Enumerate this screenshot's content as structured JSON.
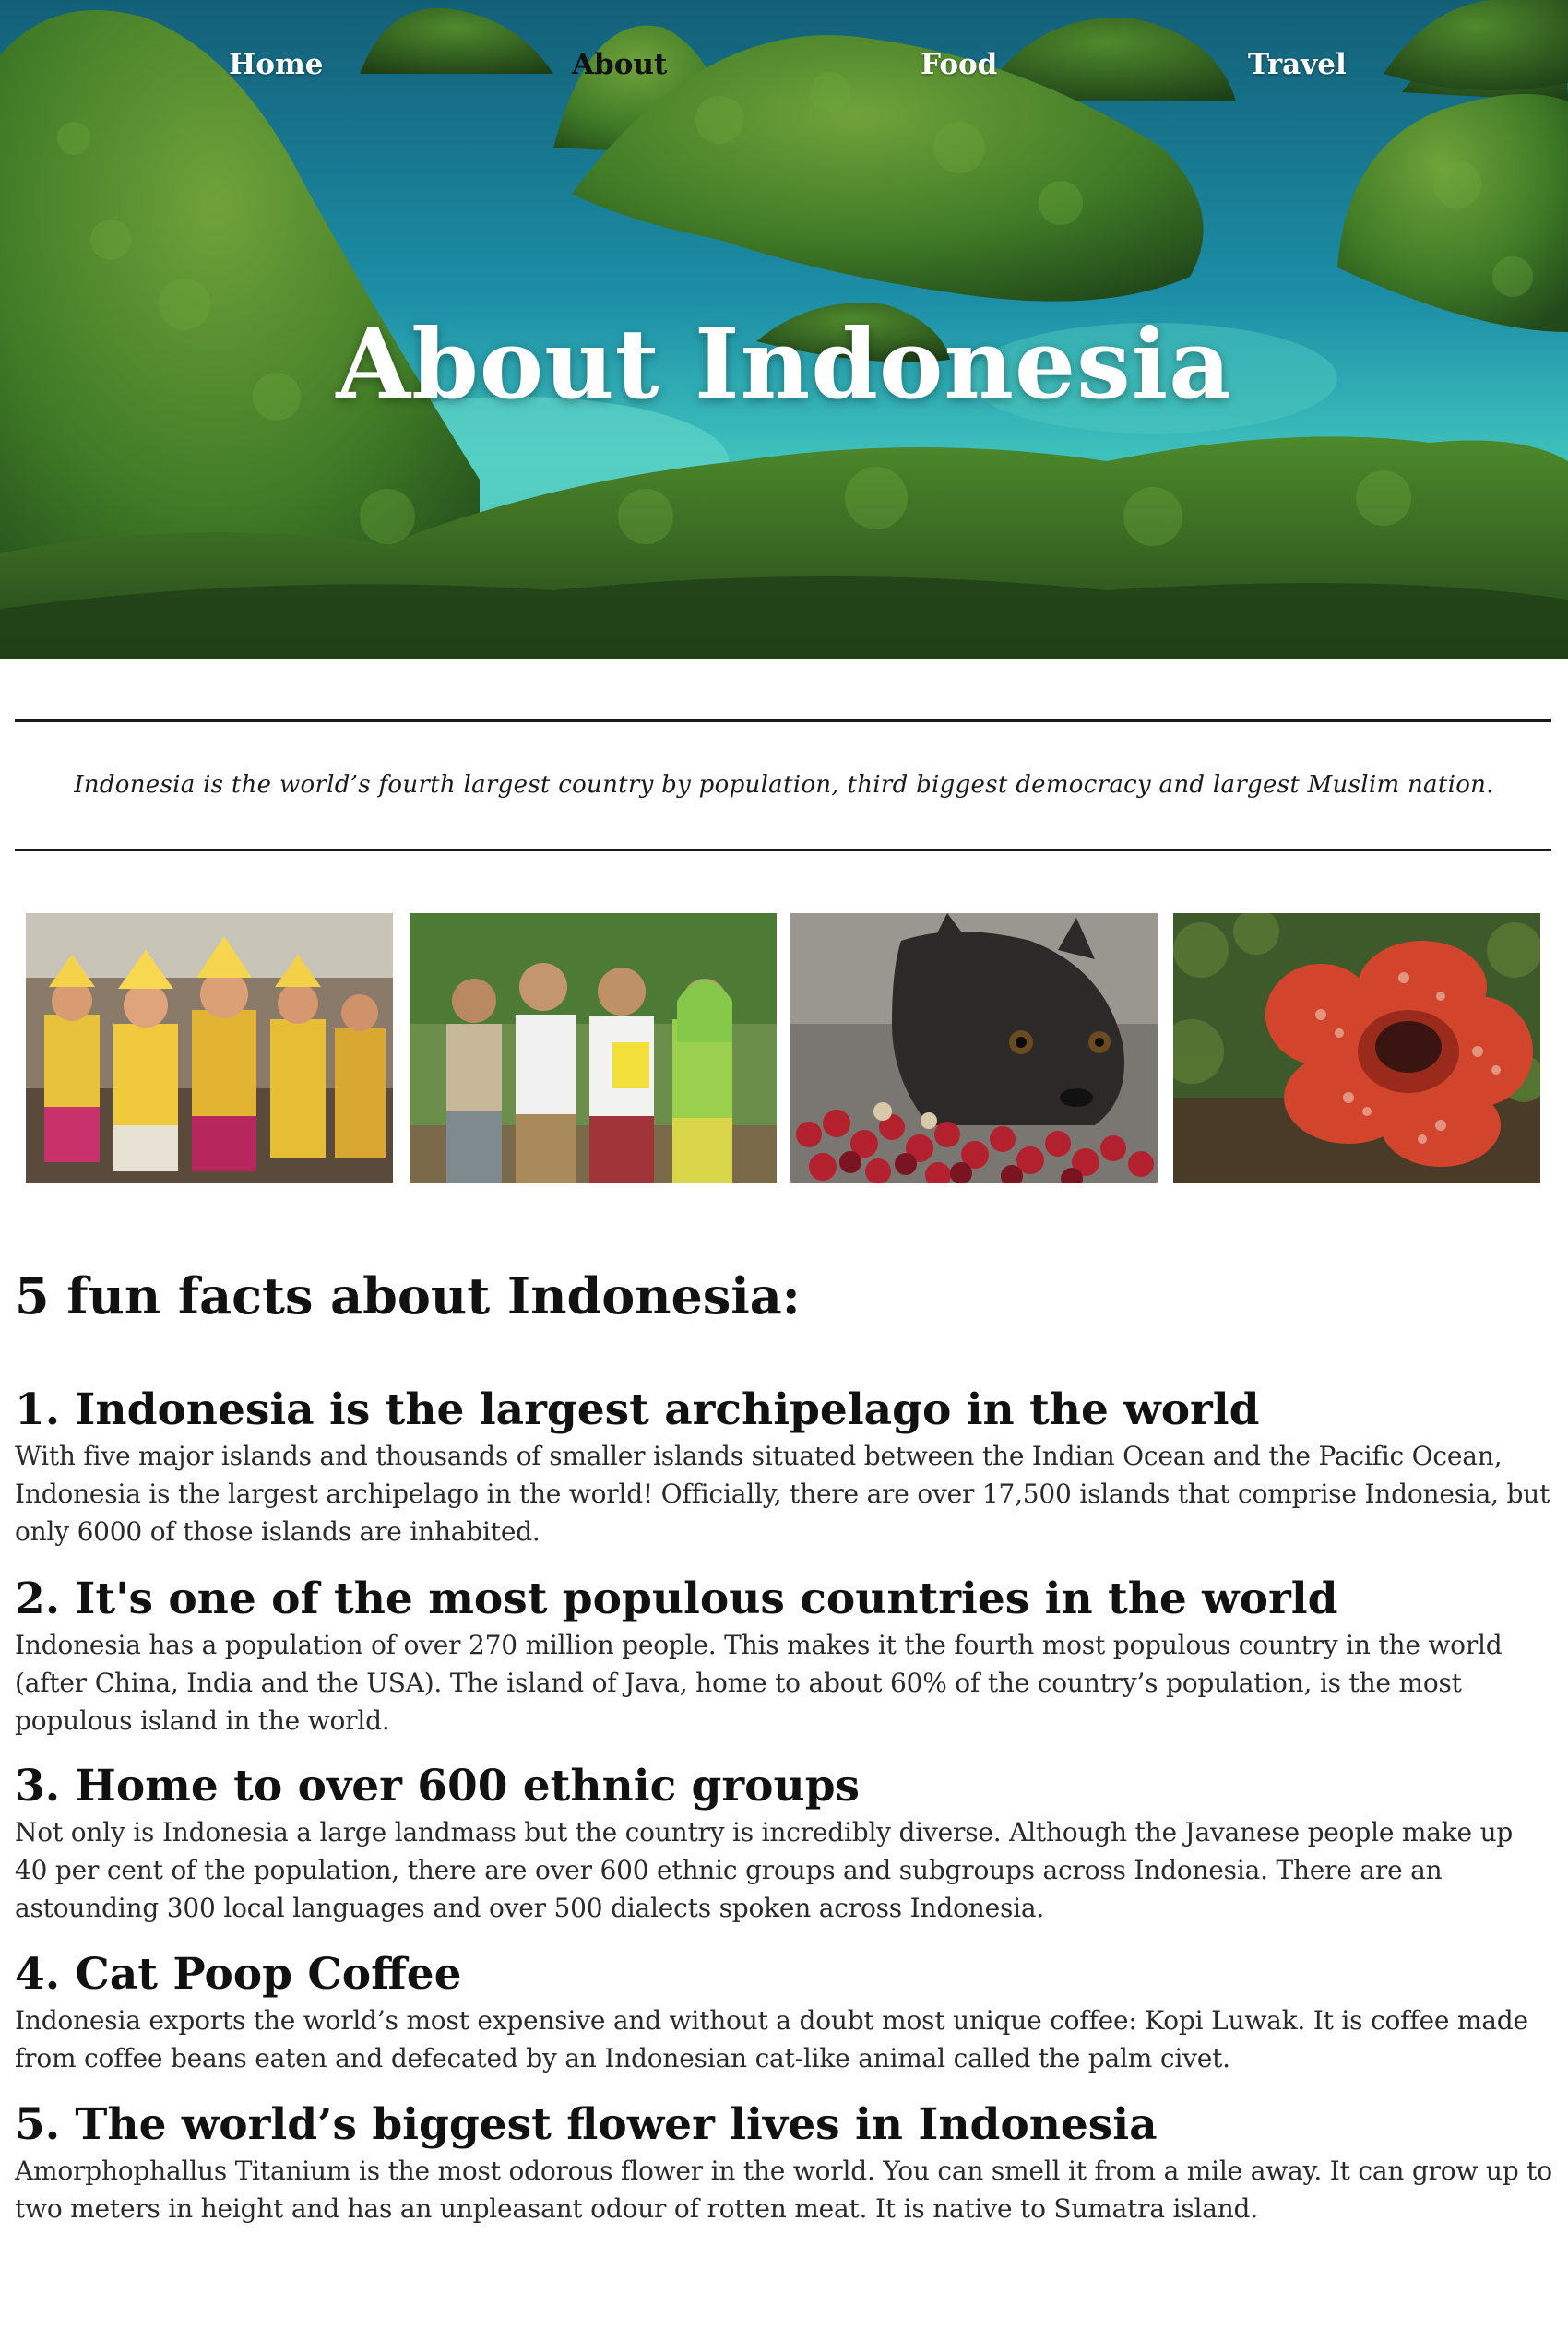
{
  "nav": {
    "items": [
      {
        "label": "Home",
        "active": false
      },
      {
        "label": "About",
        "active": true
      },
      {
        "label": "Food",
        "active": false
      },
      {
        "label": "Travel",
        "active": false
      }
    ]
  },
  "hero": {
    "title": "About Indonesia"
  },
  "tagline": "Indonesia is the world’s fourth largest country by population, third biggest democracy and largest Muslim nation.",
  "facts_heading": "5 fun facts about Indonesia:",
  "facts": [
    {
      "title": "1. Indonesia is the largest archipelago in the world",
      "body": "With five major islands and thousands of smaller islands situated between the Indian Ocean and the Pacific Ocean, Indonesia is the largest archipelago in the world! Officially, there are over 17,500 islands that comprise Indonesia, but only 6000 of those islands are inhabited."
    },
    {
      "title": "2. It's one of the most populous countries in the world",
      "body": "Indonesia has a population of over 270 million people. This makes it the fourth most populous country in the world (after China, India and the USA). The island of Java, home to about 60% of the country’s population, is the most populous island in the world."
    },
    {
      "title": "3. Home to over 600 ethnic groups",
      "body": "Not only is Indonesia a large landmass but the country is incredibly diverse. Although the Javanese people make up 40 per cent of the population, there are over 600 ethnic groups and subgroups across Indonesia. There are an astounding 300 local languages and over 500 dialects spoken across Indonesia."
    },
    {
      "title": "4. Cat Poop Coffee",
      "body": "Indonesia exports the world’s most expensive and without a doubt most unique coffee: Kopi Luwak. It is coffee made from coffee beans eaten and defecated by an Indonesian cat-like animal called the palm civet."
    },
    {
      "title": "5. The world’s biggest flower lives in Indonesia",
      "body": "Amorphophallus Titanium is the most odorous flower in the world. You can smell it from a mile away. It can grow up to two meters in height and has an unpleasant odour of rotten meat. It is native to Sumatra island."
    }
  ],
  "colors": {
    "water": "#1f93a8",
    "forest": "#2f6a25",
    "text": "#1a1a1a"
  }
}
